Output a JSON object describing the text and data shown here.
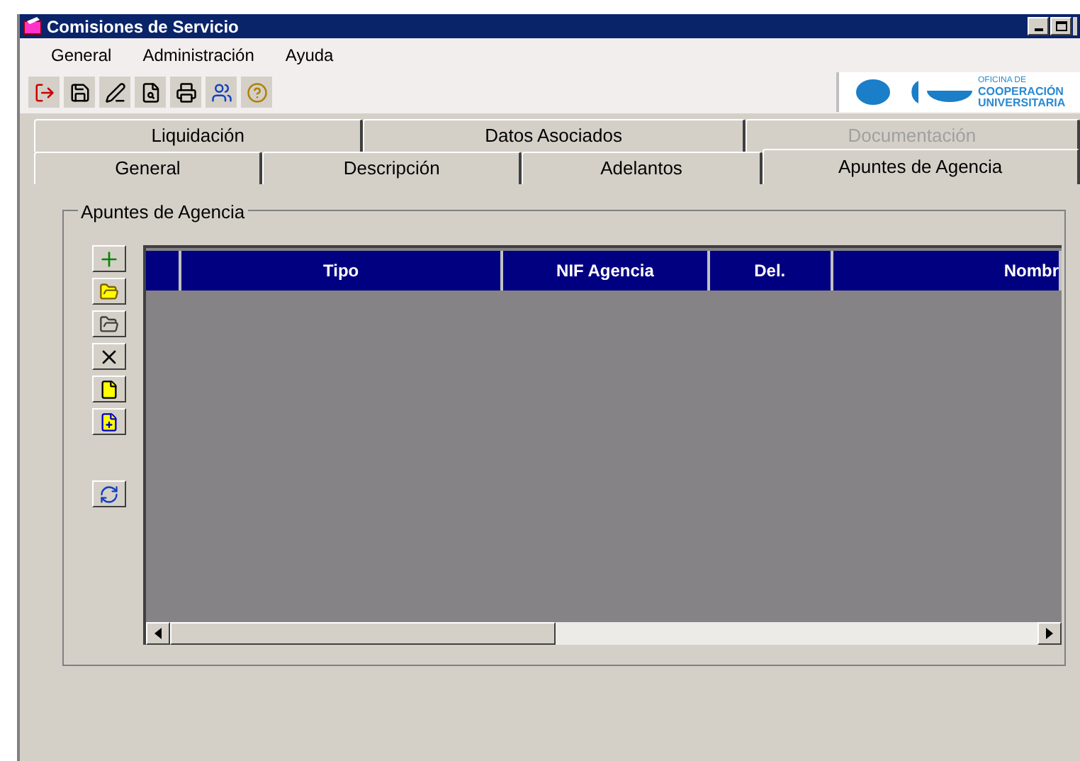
{
  "window": {
    "title": "Comisiones de Servicio"
  },
  "menu": [
    "General",
    "Administración",
    "Ayuda"
  ],
  "logo": {
    "lines": [
      "OFICINA DE",
      "COOPERACIÓN",
      "UNIVERSITARIA"
    ]
  },
  "tab_rows": [
    [
      {
        "label": "Liquidación",
        "selected": false,
        "disabled": false
      },
      {
        "label": "Datos Asociados",
        "selected": false,
        "disabled": false
      },
      {
        "label": "Documentación",
        "selected": false,
        "disabled": true
      }
    ],
    [
      {
        "label": "General",
        "selected": false,
        "disabled": false
      },
      {
        "label": "Descripción",
        "selected": false,
        "disabled": false
      },
      {
        "label": "Adelantos",
        "selected": false,
        "disabled": false
      },
      {
        "label": "Apuntes de Agencia",
        "selected": true,
        "disabled": false
      }
    ]
  ],
  "group": {
    "title": "Apuntes de Agencia"
  },
  "table": {
    "columns": [
      "",
      "Tipo",
      "NIF Agencia",
      "Del.",
      "Nombr"
    ]
  }
}
